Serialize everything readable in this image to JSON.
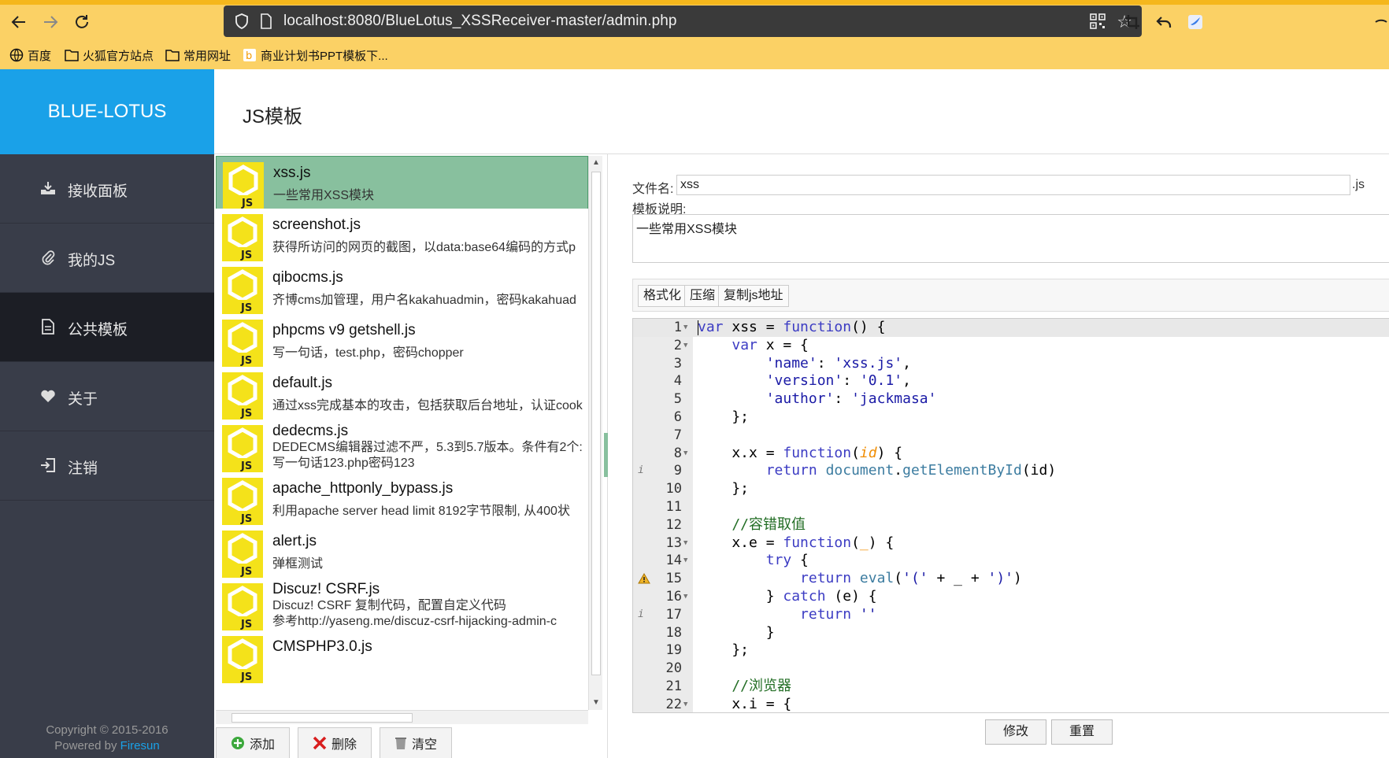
{
  "browser": {
    "url": "localhost:8080/BlueLotus_XSSReceiver-master/admin.php",
    "bookmarks": [
      "百度",
      "火狐官方站点",
      "常用网址",
      "商业计划书PPT模板下..."
    ]
  },
  "sidebar": {
    "brand": "BLUE-LOTUS",
    "items": [
      {
        "label": "接收面板",
        "icon": "download-icon"
      },
      {
        "label": "我的JS",
        "icon": "paperclip-icon"
      },
      {
        "label": "公共模板",
        "icon": "document-icon"
      },
      {
        "label": "关于",
        "icon": "heart-icon"
      },
      {
        "label": "注销",
        "icon": "logout-icon"
      }
    ],
    "active_index": 2,
    "copyright": "Copyright © 2015-2016",
    "powered_prefix": "Powered by",
    "powered_link": "Firesun"
  },
  "header": {
    "title": "JS模板"
  },
  "templates": [
    {
      "name": "xss.js",
      "desc": "一些常用XSS模块",
      "desc2": ""
    },
    {
      "name": "screenshot.js",
      "desc": "获得所访问的网页的截图，以data:base64编码的方式p",
      "desc2": ""
    },
    {
      "name": "qibocms.js",
      "desc": "齐博cms加管理，用户名kakahuadmin，密码kakahuad",
      "desc2": ""
    },
    {
      "name": "phpcms v9 getshell.js",
      "desc": "写一句话，test.php，密码chopper",
      "desc2": ""
    },
    {
      "name": "default.js",
      "desc": "通过xss完成基本的攻击，包括获取后台地址，认证cook",
      "desc2": ""
    },
    {
      "name": "dedecms.js",
      "desc": "DEDECMS编辑器过滤不严，5.3到5.7版本。条件有2个:",
      "desc2": "写一句话123.php密码123"
    },
    {
      "name": "apache_httponly_bypass.js",
      "desc": "利用apache server head limit 8192字节限制, 从400状",
      "desc2": ""
    },
    {
      "name": "alert.js",
      "desc": "弹框测试",
      "desc2": ""
    },
    {
      "name": "Discuz!  CSRF.js",
      "desc": "Discuz!  CSRF  复制代码，配置自定义代码",
      "desc2": "参考http://yaseng.me/discuz-csrf-hijacking-admin-c"
    },
    {
      "name": "CMSPHP3.0.js",
      "desc": "",
      "desc2": ""
    }
  ],
  "list_actions": {
    "add": "添加",
    "delete": "删除",
    "clear": "清空"
  },
  "editor": {
    "filename_label": "文件名:",
    "filename_value": "xss",
    "ext": ".js",
    "desc_label": "模板说明:",
    "desc_value": "一些常用XSS模块",
    "tool_format": "格式化",
    "tool_compress": "压缩",
    "tool_copy": "复制js地址",
    "save": "修改",
    "reset": "重置"
  },
  "code_lines": [
    "var xss = function() {",
    "    var x = {",
    "        'name': 'xss.js',",
    "        'version': '0.1',",
    "        'author': 'jackmasa'",
    "    };",
    "",
    "    x.x = function(id) {",
    "        return document.getElementById(id)",
    "    };",
    "",
    "    //容错取值",
    "    x.e = function(_) {",
    "        try {",
    "            return eval('(' + _ + ')')",
    "        } catch (e) {",
    "            return ''",
    "        }",
    "    };",
    "",
    "    //浏览器",
    "    x.i = {"
  ]
}
